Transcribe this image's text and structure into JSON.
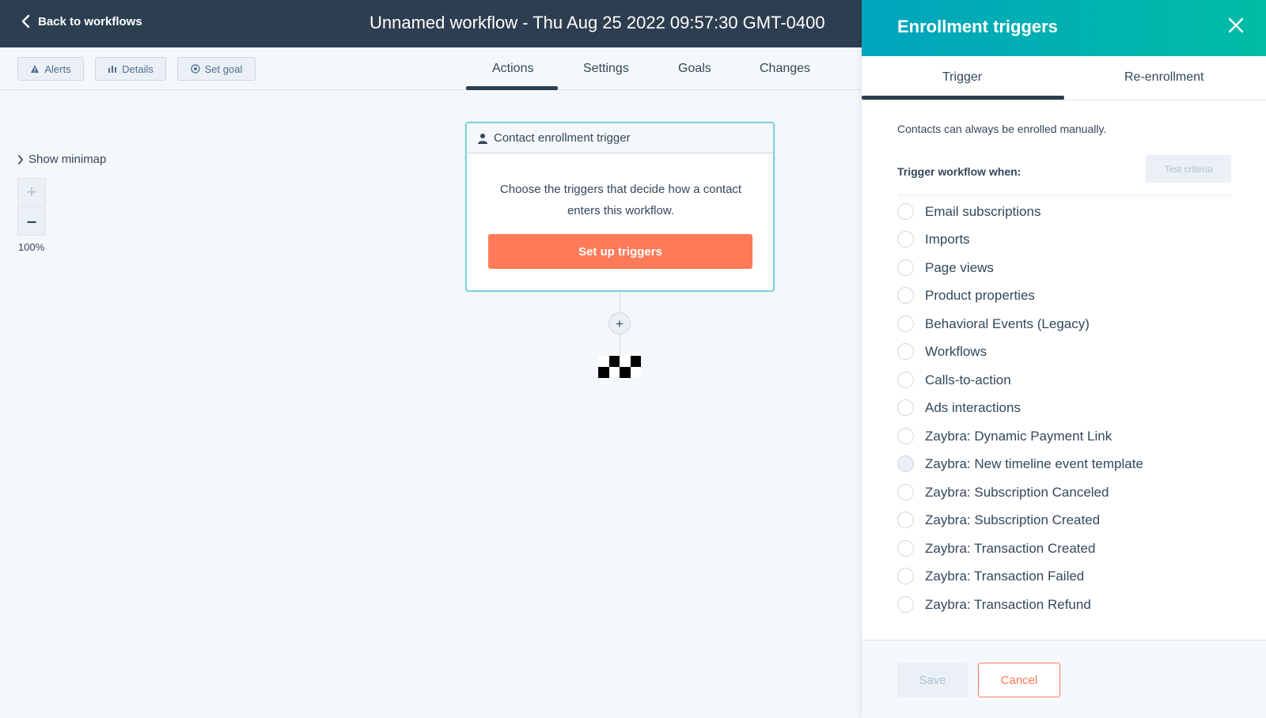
{
  "header": {
    "back_label": "Back to workflows",
    "workflow_title": "Unnamed workflow - Thu Aug 25 2022 09:57:30 GMT-0400"
  },
  "subnav": {
    "alerts_label": "Alerts",
    "details_label": "Details",
    "set_goal_label": "Set goal",
    "tabs": [
      "Actions",
      "Settings",
      "Goals",
      "Changes"
    ],
    "active_tab": "Actions"
  },
  "canvas": {
    "minimap_label": "Show minimap",
    "zoom_in": "+",
    "zoom_out": "–",
    "zoom_level": "100%",
    "card": {
      "title": "Contact enrollment trigger",
      "description": "Choose the triggers that decide how a contact enters this workflow.",
      "button_label": "Set up triggers"
    },
    "add_action": "+"
  },
  "panel": {
    "title": "Enrollment triggers",
    "tabs": [
      "Trigger",
      "Re-enrollment"
    ],
    "active_tab": "Trigger",
    "note": "Contacts can always be enrolled manually.",
    "trigger_label": "Trigger workflow when:",
    "test_criteria_label": "Test criteria",
    "options": [
      "Email subscriptions",
      "Imports",
      "Page views",
      "Product properties",
      "Behavioral Events (Legacy)",
      "Workflows",
      "Calls-to-action",
      "Ads interactions",
      "Zaybra: Dynamic Payment Link",
      "Zaybra: New timeline event template",
      "Zaybra: Subscription Canceled",
      "Zaybra: Subscription Created",
      "Zaybra: Transaction Created",
      "Zaybra: Transaction Failed",
      "Zaybra: Transaction Refund"
    ],
    "hovered_option": "Zaybra: New timeline event template",
    "save_label": "Save",
    "cancel_label": "Cancel"
  },
  "colors": {
    "header_bg": "#2d3e50",
    "accent_orange": "#ff7a59",
    "panel_teal": "#00a4bd",
    "panel_green": "#00bda5"
  }
}
